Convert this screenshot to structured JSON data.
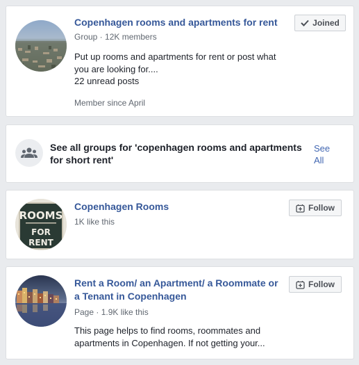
{
  "results": [
    {
      "title": "Copenhagen rooms and apartments for rent",
      "meta": "Group · 12K members",
      "description": "Put up rooms and apartments for rent or post what you are looking for....",
      "unread": "22 unread posts",
      "member_since": "Member since April",
      "action_label": "Joined",
      "action_icon": "check-icon"
    },
    {
      "see_all_text": "See all groups for 'copenhagen rooms and apartments for short rent'",
      "see_all_link": "See All",
      "icon": "groups-icon"
    },
    {
      "title": "Copenhagen Rooms",
      "meta": "1K like this",
      "avatar_text_top": "ROOMS",
      "avatar_text_mid": "FOR",
      "avatar_text_bot": "RENT",
      "action_label": "Follow",
      "action_icon": "follow-icon"
    },
    {
      "title_line1": "Rent a Room/ an Apartment/ a Roommate or",
      "title_line2": "a Tenant in Copenhagen",
      "meta": "Page · 1.9K like this",
      "description_line1": "This page helps to find rooms, roommates and",
      "description_line2": "apartments in Copenhagen. If not getting your...",
      "action_label": "Follow",
      "action_icon": "follow-icon"
    }
  ],
  "colors": {
    "link": "#365899",
    "background": "#e9ebee"
  }
}
